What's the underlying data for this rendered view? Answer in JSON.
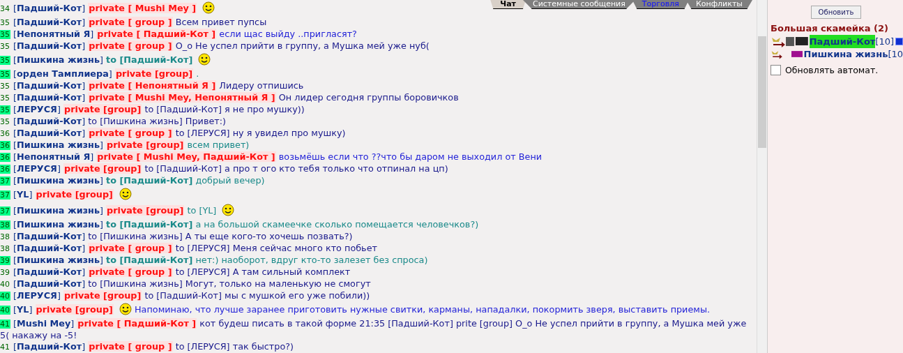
{
  "tabs": [
    {
      "label": "Чат",
      "selected": true,
      "alert": false
    },
    {
      "label": "Системные сообщения",
      "selected": false,
      "alert": false
    },
    {
      "label": "Торговля",
      "selected": false,
      "alert": true
    },
    {
      "label": "Конфликты",
      "selected": false,
      "alert": false
    }
  ],
  "messages": [
    {
      "time": "34",
      "marked": false,
      "sender": "[**Падший-Кот**]",
      "private": "private [ Mushi Mey ]",
      "emoticon": true
    },
    {
      "time": "35",
      "marked": false,
      "sender": "[**Падший-Кот**]",
      "private": "private [ group ]",
      "text": "Всем привет пупсы",
      "kind": "plain"
    },
    {
      "time": "35",
      "marked": true,
      "sender": "[**Непонятный Я**]",
      "private": "private [ Падший-Кот ]",
      "text": "если щас выйду ..пригласят?",
      "kind": "bright"
    },
    {
      "time": "35",
      "marked": false,
      "sender": "[**Падший-Кот**]",
      "private": "private [ group ]",
      "text": "О_о Не успел прийти в группу, а Мушка мей уже нуб(",
      "kind": "plain"
    },
    {
      "time": "35",
      "marked": true,
      "sender": "[**Пишкина жизнь**]",
      "to": {
        "text": "to [Падший-Кот]",
        "bold": true
      },
      "emoticon": true,
      "kind": "teal"
    },
    {
      "time": "35",
      "marked": true,
      "sender": "[**орден Тамплиера**]",
      "private": "private [group]",
      "text": ".",
      "kind": "teal"
    },
    {
      "time": "35",
      "marked": false,
      "sender": "[**Падший-Кот**]",
      "private": "private [ Непонятный Я ]",
      "text": "Лидеру отпишись",
      "kind": "plain"
    },
    {
      "time": "35",
      "marked": false,
      "sender": "[**Падший-Кот**]",
      "private": "private [ Mushi Mey, Непонятный Я ]",
      "text": "Он лидер сегодня группы боровичков",
      "kind": "plain"
    },
    {
      "time": "35",
      "marked": true,
      "sender": "[**ЛЕРУСЯ**]",
      "private": "private [group]",
      "to": {
        "text": "to [Падший-Кот]",
        "bold": false
      },
      "text": "я не про мушку))",
      "kind": "plain"
    },
    {
      "time": "35",
      "marked": false,
      "sender": "[**Падший-Кот**]",
      "to": {
        "text": "to [Пишкина жизнь]",
        "bold": false
      },
      "text": "Привет:)",
      "kind": "plain"
    },
    {
      "time": "36",
      "marked": false,
      "sender": "[**Падший-Кот**]",
      "private": "private [ group ]",
      "to": {
        "text": "to [ЛЕРУСЯ]",
        "bold": false
      },
      "text": "ну я увидел про мушку)",
      "kind": "plain"
    },
    {
      "time": "36",
      "marked": true,
      "sender": "[**Пишкина жизнь**]",
      "private": "private [group]",
      "text": "всем привет)",
      "kind": "teal"
    },
    {
      "time": "36",
      "marked": true,
      "sender": "[**Непонятный Я**]",
      "private": "private [ Mushi Mey, Падший-Кот ]",
      "text": "возьмёшь если что ??что бы даром не выходил от Вени",
      "kind": "bright"
    },
    {
      "time": "36",
      "marked": true,
      "sender": "[**ЛЕРУСЯ**]",
      "private": "private [group]",
      "to": {
        "text": "to [Падший-Кот]",
        "bold": false
      },
      "text": "а про т ого кто тебя только что отпинал на цп)",
      "kind": "plain"
    },
    {
      "time": "37",
      "marked": true,
      "sender": "[**Пишкина жизнь**]",
      "to": {
        "text": "to [Падший-Кот]",
        "bold": true
      },
      "text": "добрый вечер)",
      "kind": "teal"
    },
    {
      "time": "37",
      "marked": true,
      "sender": "[**YL**]",
      "private": "private [group]",
      "emoticon": true
    },
    {
      "time": "37",
      "marked": true,
      "sender": "[**Пишкина жизнь**]",
      "private": "private [group]",
      "to": {
        "text": "to [YL]",
        "bold": false
      },
      "emoticon": true,
      "kind": "teal"
    },
    {
      "time": "38",
      "marked": true,
      "sender": "[**Пишкина жизнь**]",
      "to": {
        "text": "to [Падший-Кот]",
        "bold": true
      },
      "text": "а на большой скамеечке сколько помещается человечков?)",
      "kind": "teal"
    },
    {
      "time": "38",
      "marked": false,
      "sender": "[**Падший-Кот**]",
      "to": {
        "text": "to [Пишкина жизнь]",
        "bold": false
      },
      "text": "А ты еще кого-то хочешь позвать?)",
      "kind": "plain"
    },
    {
      "time": "38",
      "marked": false,
      "sender": "[**Падший-Кот**]",
      "private": "private [ group ]",
      "to": {
        "text": "to [ЛЕРУСЯ]",
        "bold": false
      },
      "text": "Меня сейчас много кто побьет",
      "kind": "plain"
    },
    {
      "time": "39",
      "marked": true,
      "sender": "[**Пишкина жизнь**]",
      "to": {
        "text": "to [Падший-Кот]",
        "bold": true
      },
      "text": "нет:) наоборот, вдруг кто-то залезет без спроса)",
      "kind": "teal"
    },
    {
      "time": "39",
      "marked": false,
      "sender": "[**Падший-Кот**]",
      "private": "private [ group ]",
      "to": {
        "text": "to [ЛЕРУСЯ]",
        "bold": false
      },
      "text": "А там сильный комплект",
      "kind": "plain"
    },
    {
      "time": "40",
      "marked": false,
      "sender": "[**Падший-Кот**]",
      "to": {
        "text": "to [Пишкина жизнь]",
        "bold": false
      },
      "text": "Могут, только на маленькую не смогут",
      "kind": "plain"
    },
    {
      "time": "40",
      "marked": true,
      "sender": "[**ЛЕРУСЯ**]",
      "private": "private [group]",
      "to": {
        "text": "to [Падший-Кот]",
        "bold": false
      },
      "text": "мы с мушкой его уже побили))",
      "kind": "plain"
    },
    {
      "time": "40",
      "marked": true,
      "sender": "[**YL**]",
      "private": "private [group]",
      "emoticon": true,
      "text": "Напоминаю, что лучше заранее приготовить нужные свитки, карманы, нападалки, покормить зверя, выставить приемы.",
      "kind": "bright"
    },
    {
      "time": "41",
      "marked": true,
      "sender": "[**Mushi Mey**]",
      "private": "private [ Падший-Кот ]",
      "text": "кот будеш писать в такой форме 21:35 [Падший-Кот] prite [group] О_о Не успел прийти в группу, а Мушка мей уже",
      "continuation": "5( накажу на -5!",
      "kind": "plain"
    },
    {
      "time": "41",
      "marked": false,
      "sender": "[**Падший-Кот**]",
      "private": "private [ group ]",
      "to": {
        "text": "to [ЛЕРУСЯ]",
        "bold": false
      },
      "text": "так быстро?)",
      "kind": "plain"
    }
  ],
  "panel": {
    "refresh_button": "Обновить",
    "room": "Большая скамейка (2)",
    "members": [
      {
        "name": "Падший-Кот",
        "level": "[10]",
        "highlighted": true,
        "info": true
      },
      {
        "name": "Пишкина жизнь",
        "level": "[10",
        "highlighted": false
      }
    ],
    "auto_refresh": {
      "label": "Обновлять автомат.",
      "checked": false
    }
  }
}
